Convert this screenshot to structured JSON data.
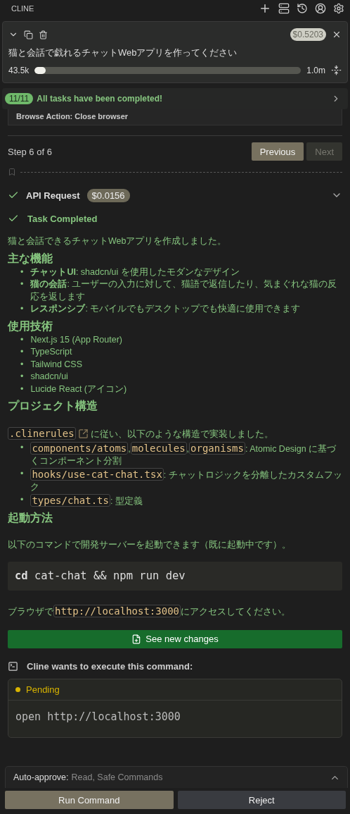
{
  "header": {
    "title": "CLINE"
  },
  "task": {
    "title": "猫と会話で戯れるチャットWebアプリを作ってください",
    "cost": "$0.5203",
    "tokens_used": "43.5k",
    "context_window": "1.0m",
    "level": 0.04
  },
  "todo_banner": {
    "count": "11/11",
    "message": "All tasks have been completed!"
  },
  "previous_step": {
    "text": "Browse Action: Close browser"
  },
  "step_nav": {
    "label": "Step 6 of 6",
    "buttons": [
      {
        "label": "Previous",
        "disabled": false
      },
      {
        "label": "Next",
        "disabled": true
      }
    ]
  },
  "api_request": {
    "label": "API Request",
    "cost": "$0.0156",
    "done": true
  },
  "completion": {
    "title": "Task Completed",
    "blocks": [
      {
        "kind": "paragraph",
        "segments": [
          {
            "kind": "text",
            "text": "猫と会話できるチャットWebアプリを作成しました。"
          }
        ]
      },
      {
        "kind": "heading",
        "text": "主な機能"
      },
      {
        "kind": "list",
        "items": [
          {
            "marker": "•",
            "segments": [
              {
                "kind": "text",
                "text": "**チャットUI**: shadcn/ui を使用したモダンなデザイン"
              }
            ]
          },
          {
            "marker": "•",
            "segments": [
              {
                "kind": "text",
                "text": "**猫の会話**: ユーザーの入力に対して、猫語で返信したり、気まぐれな猫の反応を返します"
              }
            ]
          },
          {
            "marker": "•",
            "segments": [
              {
                "kind": "text",
                "text": "**レスポンシブ**: モバイルでもデスクトップでも快適に使用できます"
              }
            ]
          }
        ]
      },
      {
        "kind": "heading",
        "text": "使用技術"
      },
      {
        "kind": "list",
        "items": [
          {
            "marker": "•",
            "segments": [
              {
                "kind": "text",
                "text": "Next.js 15 (App Router)"
              }
            ]
          },
          {
            "marker": "•",
            "segments": [
              {
                "kind": "text",
                "text": "TypeScript"
              }
            ]
          },
          {
            "marker": "•",
            "segments": [
              {
                "kind": "text",
                "text": "Tailwind CSS"
              }
            ]
          },
          {
            "marker": "•",
            "segments": [
              {
                "kind": "text",
                "text": "shadcn/ui"
              }
            ]
          },
          {
            "marker": "•",
            "segments": [
              {
                "kind": "text",
                "text": "Lucide React (アイコン)"
              }
            ]
          }
        ]
      },
      {
        "kind": "heading",
        "text": "プロジェクト構造"
      },
      {
        "kind": "paragraph",
        "segments": [
          {
            "kind": "file",
            "text": ".clinerules"
          },
          {
            "kind": "text",
            "text": "に従い、以下のような構造で実装しました。"
          }
        ]
      },
      {
        "kind": "list",
        "items": [
          {
            "marker": "•",
            "segments": [
              {
                "kind": "code",
                "text": "components/atoms"
              },
              {
                "kind": "text",
                "text": ","
              },
              {
                "kind": "code",
                "text": "molecules"
              },
              {
                "kind": "text",
                "text": ","
              },
              {
                "kind": "code",
                "text": "organisms"
              },
              {
                "kind": "text",
                "text": ": Atomic Design に基づくコンポーネント分割"
              }
            ]
          },
          {
            "marker": "•",
            "segments": [
              {
                "kind": "code",
                "text": "hooks/use-cat-chat.tsx"
              },
              {
                "kind": "text",
                "text": ": チャットロジックを分離したカスタムフック"
              }
            ]
          },
          {
            "marker": "•",
            "segments": [
              {
                "kind": "code",
                "text": "types/chat.ts"
              },
              {
                "kind": "text",
                "text": ": 型定義"
              }
            ]
          }
        ]
      },
      {
        "kind": "heading",
        "text": "起動方法"
      },
      {
        "kind": "paragraph",
        "segments": [
          {
            "kind": "text",
            "text": "以下のコマンドで開発サーバーを起動できます（既に起動中です）。"
          }
        ]
      },
      {
        "kind": "code_block",
        "command": "cd",
        "args": "cat-chat && npm run dev"
      },
      {
        "kind": "paragraph",
        "segments": [
          {
            "kind": "text",
            "text": "ブラウザで"
          },
          {
            "kind": "code",
            "text": "http://localhost:3000"
          },
          {
            "kind": "text",
            "text": "にアクセスしてください。"
          }
        ]
      }
    ]
  },
  "see_changes_button": {
    "label": "See new changes"
  },
  "command": {
    "title": "Cline wants to execute this command:",
    "status": "Pending",
    "command": "open http://localhost:3000"
  },
  "auto_approve": {
    "label": "Auto-approve:",
    "value": "Read, Safe Commands",
    "expanded": false
  },
  "actions": [
    {
      "label": "Run Command",
      "kind": "primary"
    },
    {
      "label": "Reject",
      "kind": "secondary"
    }
  ]
}
